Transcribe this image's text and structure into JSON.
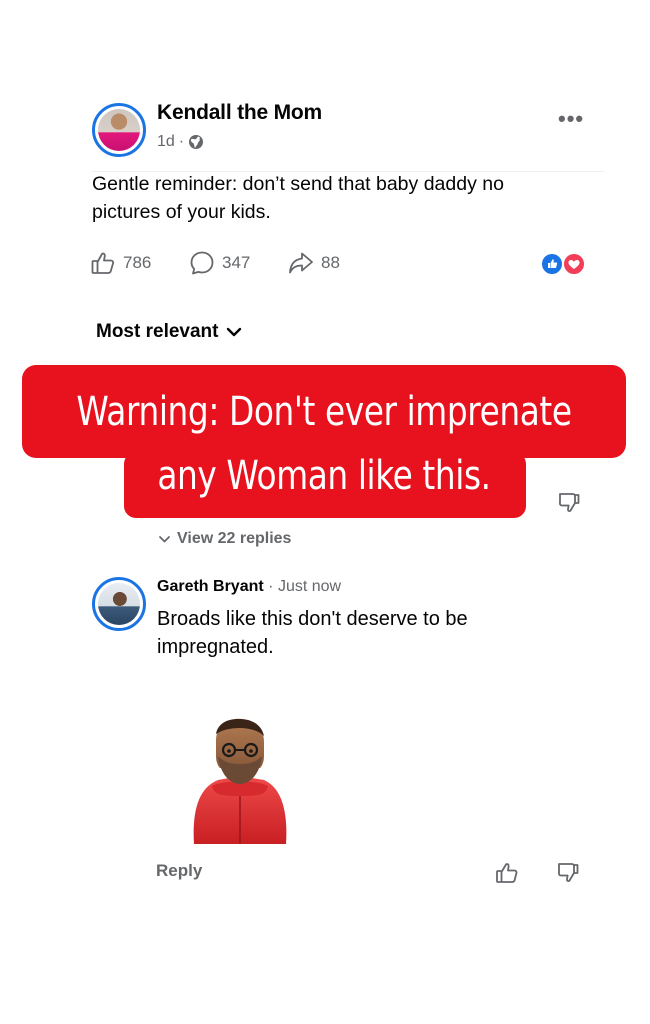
{
  "post": {
    "author": "Kendall the Mom",
    "age": "1d",
    "separator": "·",
    "body": "Gentle reminder: don’t send that baby daddy  no pictures of your kids.",
    "more_icon": "more-horizontal-icon",
    "privacy_icon": "globe-icon"
  },
  "actions": {
    "likes": "786",
    "comments": "347",
    "shares": "88"
  },
  "reactions": [
    "like",
    "love"
  ],
  "sort": {
    "label": "Most relevant"
  },
  "banner": {
    "line1": "Warning: Don't ever imprenate",
    "line2": "any Woman like this.",
    "color": "#e8111e"
  },
  "replies": {
    "view_label": "View 22 replies"
  },
  "comment": {
    "author": "Gareth Bryant",
    "time": "Just now",
    "separator": "·",
    "body": "Broads like this don't deserve to be impregnated.",
    "reply_label": "Reply"
  },
  "colors": {
    "accent": "#1b74e4",
    "secondary_text": "#65676b",
    "love": "#f33e58"
  }
}
